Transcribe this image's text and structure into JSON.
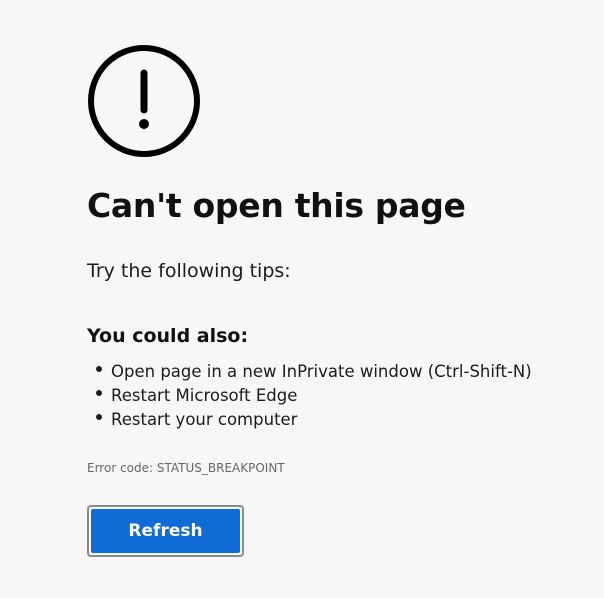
{
  "error_icon": "exclamation-circle-icon",
  "title": "Can't open this page",
  "tips_intro": "Try the following tips:",
  "could_also_heading": "You could also:",
  "suggestions": [
    "Open page in a new InPrivate window (Ctrl-Shift-N)",
    "Restart Microsoft Edge",
    "Restart your computer"
  ],
  "error_code": "Error code: STATUS_BREAKPOINT",
  "refresh_label": "Refresh",
  "colors": {
    "background": "#f7f7f7",
    "accent": "#0f6cd6",
    "text": "#111111",
    "muted": "#666666"
  }
}
